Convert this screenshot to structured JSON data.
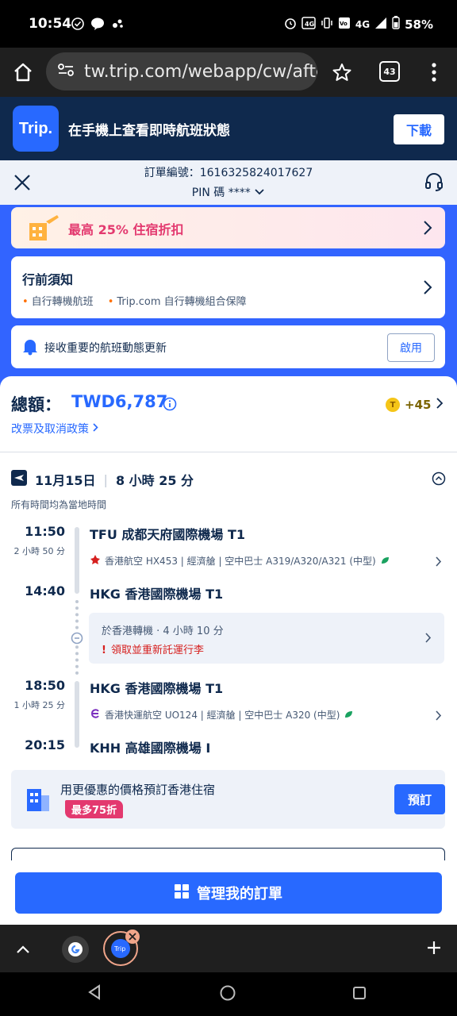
{
  "status_bar": {
    "time": "10:54",
    "network": "4G",
    "battery": "58%"
  },
  "browser": {
    "url": "tw.trip.com/webapp/cw/afte",
    "tab_count": "43"
  },
  "app_banner": {
    "logo": "Trip.",
    "text": "在手機上查看即時航班狀態",
    "download_label": "下載"
  },
  "order": {
    "order_no": "訂單編號：1616325824017627",
    "pin": "PIN 碼 ****"
  },
  "promo": {
    "text": "最高 25% 住宿折扣"
  },
  "pre_trip": {
    "title": "行前須知",
    "items": [
      "自行轉機航班",
      "Trip.com 自行轉機組合保障"
    ]
  },
  "alert": {
    "text": "接收重要的航班動態更新",
    "button": "啟用"
  },
  "total": {
    "label": "總額：",
    "amount": "TWD6,787",
    "points": "+45",
    "policy_link": "改票及取消政策"
  },
  "itinerary": {
    "date": "11月15日",
    "duration": "8 小時 25 分",
    "tz_note": "所有時間均為當地時間",
    "segments": [
      {
        "dep_time": "11:50",
        "dep_airport": "TFU  成都天府國際機場 T1",
        "flight_dur": "2 小時 50 分",
        "info": "香港航空 HX453 | 經濟艙 | 空中巴士 A319/A320/A321 (中型)",
        "arr_time": "14:40",
        "arr_airport": "HKG  香港國際機場 T1"
      },
      {
        "dep_time": "18:50",
        "dep_airport": "HKG  香港國際機場 T1",
        "flight_dur": "1 小時 25 分",
        "info": "香港快運航空 UO124 | 經濟艙 | 空中巴士 A320 (中型)",
        "arr_time": "20:15",
        "arr_airport": "KHH  高雄國際機場 I"
      }
    ],
    "transfer": {
      "text": "於香港轉機 · 4 小時 10 分",
      "warning": "領取並重新託運行李"
    }
  },
  "hotel": {
    "title": "用更優惠的價格預訂香港住宿",
    "badge": "最多75折",
    "button": "預訂"
  },
  "manage_button": "管理我的訂單",
  "colors": {
    "brand_blue": "#2869ff",
    "dark_navy": "#0f294d",
    "promo_pink": "#e3396f",
    "warn_red": "#d6201f"
  }
}
